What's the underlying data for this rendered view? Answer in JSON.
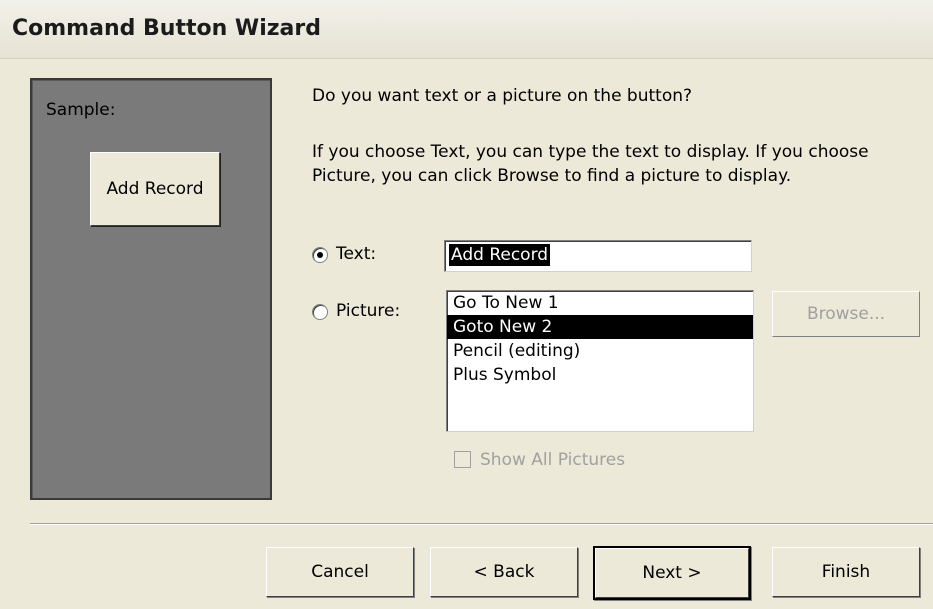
{
  "window": {
    "title": "Command Button Wizard"
  },
  "sample": {
    "label": "Sample:",
    "button_text": "Add Record"
  },
  "question": "Do you want text or a picture on the button?",
  "explanation": "If you choose Text, you can type the text to display.  If you choose Picture, you can click Browse to find a picture to display.",
  "options": {
    "text": {
      "label": "Text:",
      "selected": true,
      "value": "Add Record"
    },
    "picture": {
      "label": "Picture:",
      "selected": false,
      "items": [
        "Go To New 1",
        "Goto New 2",
        "Pencil (editing)",
        "Plus Symbol"
      ],
      "selected_index": 1,
      "browse_label": "Browse..."
    }
  },
  "show_all_pictures": {
    "label": "Show All Pictures",
    "checked": false,
    "enabled": false
  },
  "buttons": {
    "cancel": "Cancel",
    "back": "< Back",
    "next": "Next >",
    "finish": "Finish"
  }
}
